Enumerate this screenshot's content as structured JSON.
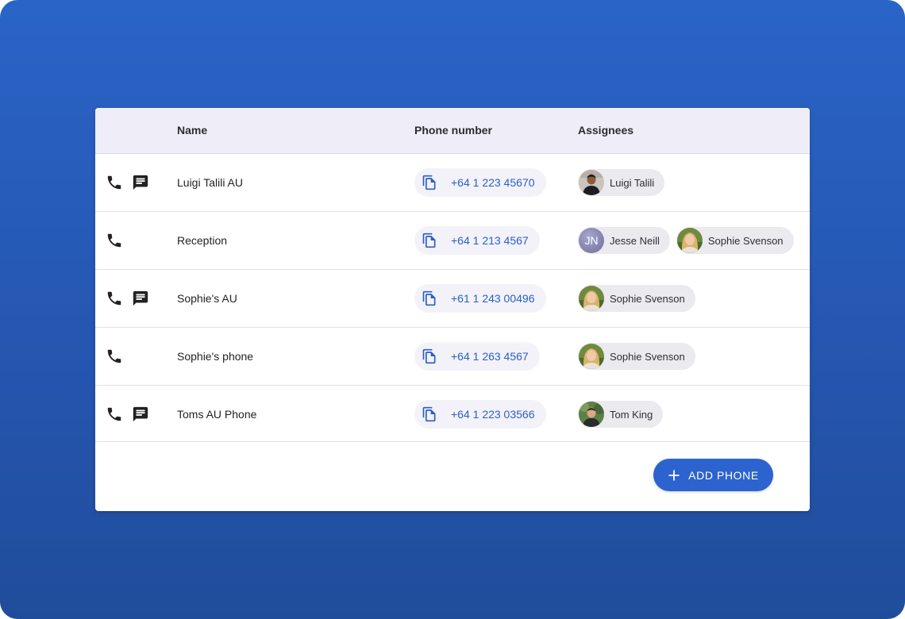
{
  "table": {
    "headers": {
      "name": "Name",
      "phone": "Phone number",
      "assignees": "Assignees"
    },
    "rows": [
      {
        "name": "Luigi Talili AU",
        "phone": "+64 1 223 45670",
        "has_sms": true,
        "assignees": [
          {
            "name": "Luigi Talili",
            "avatar": "photo-luigi"
          }
        ]
      },
      {
        "name": "Reception",
        "phone": "+64 1 213 4567",
        "has_sms": false,
        "assignees": [
          {
            "name": "Jesse Neill",
            "avatar": "initials",
            "initials": "JN"
          },
          {
            "name": "Sophie Svenson",
            "avatar": "photo-sophie"
          }
        ]
      },
      {
        "name": "Sophie's AU",
        "phone": "+61 1 243 00496",
        "has_sms": true,
        "assignees": [
          {
            "name": "Sophie Svenson",
            "avatar": "photo-sophie"
          }
        ]
      },
      {
        "name": "Sophie's phone",
        "phone": "+64 1 263 4567",
        "has_sms": false,
        "assignees": [
          {
            "name": "Sophie Svenson",
            "avatar": "photo-sophie"
          }
        ]
      },
      {
        "name": "Toms AU Phone",
        "phone": "+64 1 223 03566",
        "has_sms": true,
        "assignees": [
          {
            "name": "Tom King",
            "avatar": "photo-tom"
          }
        ]
      }
    ]
  },
  "add_button": {
    "label": "ADD PHONE",
    "icon": "plus-icon"
  },
  "icons": {
    "call": "phone-icon",
    "sms": "message-icon",
    "copy": "copy-icon"
  },
  "colors": {
    "background_top": "#2a64c7",
    "background_bottom": "#204d9b",
    "header_bg": "#efeef8",
    "accent": "#2d63cf",
    "phone_text": "#2a5fc4"
  }
}
